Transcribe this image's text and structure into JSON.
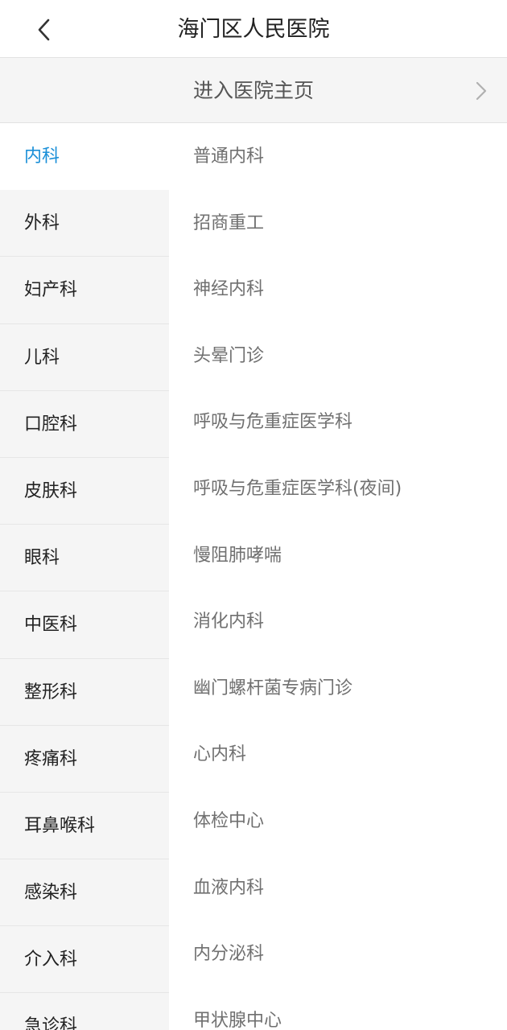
{
  "header": {
    "title": "海门区人民医院",
    "back_icon": "chevron-left-icon"
  },
  "home_entry": {
    "label": "进入医院主页",
    "chevron_icon": "chevron-right-icon"
  },
  "colors": {
    "accent": "#1a8fd8",
    "sidebar_bg": "#f5f5f5",
    "sub_text": "#707070"
  },
  "departments": [
    {
      "label": "内科",
      "active": true
    },
    {
      "label": "外科"
    },
    {
      "label": "妇产科"
    },
    {
      "label": "儿科"
    },
    {
      "label": "口腔科"
    },
    {
      "label": "皮肤科"
    },
    {
      "label": "眼科"
    },
    {
      "label": "中医科"
    },
    {
      "label": "整形科"
    },
    {
      "label": "疼痛科"
    },
    {
      "label": "耳鼻喉科"
    },
    {
      "label": "感染科"
    },
    {
      "label": "介入科"
    },
    {
      "label": "急诊科"
    }
  ],
  "sub_departments": [
    "普通内科",
    "招商重工",
    "神经内科",
    "头晕门诊",
    "呼吸与危重症医学科",
    "呼吸与危重症医学科(夜间)",
    "慢阻肺哮喘",
    "消化内科",
    "幽门螺杆菌专病门诊",
    "心内科",
    "体检中心",
    "血液内科",
    "内分泌科",
    "甲状腺中心"
  ]
}
